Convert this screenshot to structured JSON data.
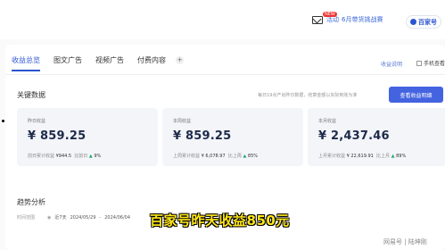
{
  "header": {
    "badge": "NEW",
    "notice_prefix": "活动",
    "notice_text": "6月带货挑战赛",
    "cta_label": "百家号"
  },
  "tabs": [
    {
      "label": "收益总览",
      "active": true
    },
    {
      "label": "图文广告",
      "active": false
    },
    {
      "label": "视频广告",
      "active": false
    },
    {
      "label": "付费内容",
      "active": false
    }
  ],
  "tab_add": "+",
  "rules_link": "收益说明",
  "mobile_label": "手机查看",
  "key_data": {
    "title": "关键数据",
    "note": "每日19点产出昨日数据，结算金额以实际到账为准",
    "detail_button": "查看收益明细"
  },
  "stats": [
    {
      "label": "昨日收益",
      "value": "¥ 859.25",
      "compare_label": "前日累计收益",
      "compare_value": "¥944.5",
      "ratio_label": "比前日",
      "ratio_value": "9%"
    },
    {
      "label": "本周收益",
      "value": "¥ 859.25",
      "compare_label": "上周累计收益",
      "compare_value": "¥ 6,078.97",
      "ratio_label": "比上周",
      "ratio_value": "85%"
    },
    {
      "label": "本月收益",
      "value": "¥ 2,437.46",
      "compare_label": "上月累计收益",
      "compare_value": "¥ 22,619.91",
      "ratio_label": "比上月",
      "ratio_value": "89%"
    }
  ],
  "trend": {
    "title": "趋势分析",
    "time_label": "时间范围",
    "range_label": "近7天",
    "start_date": "2024/05/29",
    "end_date": "2024/06/04"
  },
  "caption": "百家号昨天收益850元",
  "watermark": "网易号 | 陆坤刚",
  "colors": {
    "accent": "#4463e0",
    "up": "#27a86b",
    "caption": "#ffe61a"
  }
}
